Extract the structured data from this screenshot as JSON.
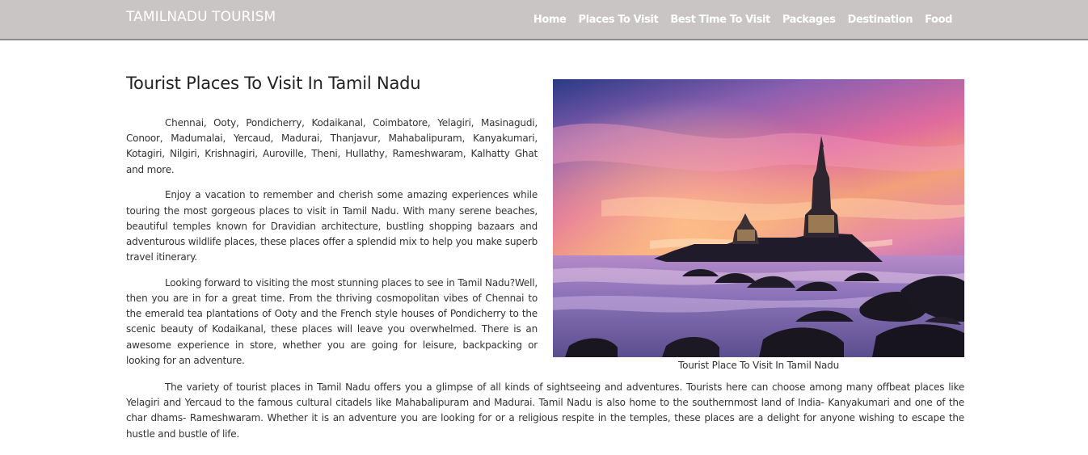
{
  "nav": {
    "brand": "TAMILNADU TOURISM",
    "links": [
      "Home",
      "Places To Visit",
      "Best Time To Visit",
      "Packages",
      "Destination",
      "Food"
    ]
  },
  "main": {
    "heading": "Tourist Places To Visit In Tamil Nadu",
    "paragraphs": [
      "Chennai, Ooty, Pondicherry, Kodaikanal, Coimbatore, Yelagiri, Masinagudi, Conoor, Madumalai, Yercaud, Madurai, Thanjavur, Mahabalipuram, Kanyakumari, Kotagiri, Nilgiri, Krishnagiri, Auroville, Theni, Hullathy, Rameshwaram, Kalhatty Ghat and more.",
      "Enjoy a vacation to remember and cherish some amazing experiences while touring the most gorgeous places to visit in Tamil Nadu. With many serene beaches, beautiful temples known for Dravidian architecture, bustling shopping bazaars and adventurous wildlife places, these places offer a splendid mix to help you make superb travel itinerary.",
      "Looking forward to visiting the most stunning places to see in Tamil Nadu?Well, then you are in for a great time. From the thriving cosmopolitan vibes of Chennai to the emerald tea plantations of Ooty and the French style houses of Pondicherry to the scenic beauty of Kodaikanal, these places will leave you overwhelmed. There is an awesome experience in store, whether you are going for leisure, backpacking or looking for an adventure."
    ],
    "image_caption": "Tourist Place To Visit In Tamil Nadu",
    "bottom_paragraph": "The variety of tourist places in Tamil Nadu offers you a glimpse of all kinds of sightseeing and adventures. Tourists here can choose among many offbeat places like Yelagiri and Yercaud to the famous cultural citadels like Mahabalipuram and Madurai. Tamil Nadu is also home to the southernmost land of India- Kanyakumari and one of the char dhams- Rameshwaram. Whether it is an adventure you are looking for or a religious respite in the temples, these places are a delight for anyone wishing to escape the hustle and bustle of life."
  },
  "colors": {
    "navbar_bg": "#c8c5c4",
    "nav_text": "#ffffff",
    "body_text": "#333333"
  }
}
